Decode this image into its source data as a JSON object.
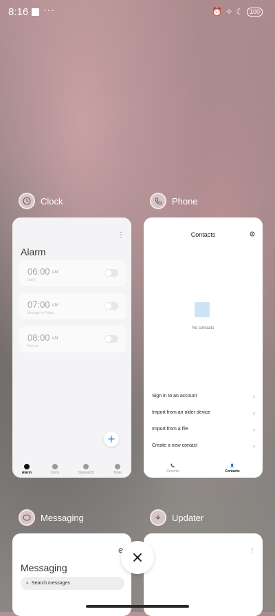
{
  "status": {
    "time": "8:16",
    "dots": "···",
    "battery": "100"
  },
  "apps": [
    {
      "name": "Clock",
      "alarm_title": "Alarm",
      "alarms": [
        {
          "time": "06:00",
          "ampm": "AM",
          "sub": "Daily"
        },
        {
          "time": "07:00",
          "ampm": "AM",
          "sub": "Monday to Friday"
        },
        {
          "time": "08:00",
          "ampm": "AM",
          "sub": "Not set"
        }
      ],
      "fab": "+",
      "tabs": [
        "Alarm",
        "Clock",
        "Stopwatch",
        "Timer"
      ]
    },
    {
      "name": "Phone",
      "title": "Contacts",
      "empty_text": "No contacts",
      "options": [
        "Sign in to an account",
        "Import from an older device",
        "Import from a file",
        "Create a new contact"
      ],
      "tabs": [
        "Recents",
        "Contacts"
      ]
    },
    {
      "name": "Messaging",
      "title": "Messaging",
      "search_placeholder": "Search messages"
    },
    {
      "name": "Updater"
    }
  ],
  "close_label": "×"
}
